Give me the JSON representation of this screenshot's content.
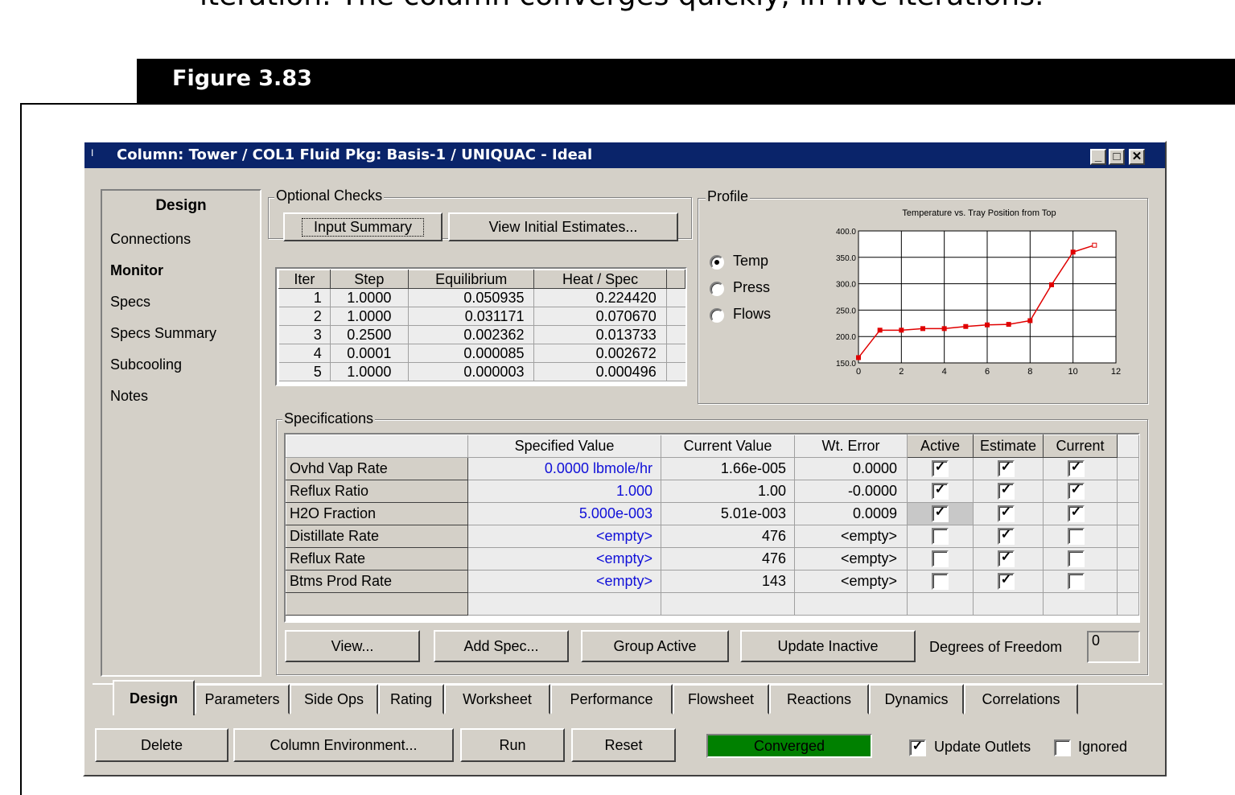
{
  "doc": {
    "top_text": "iteration. The column converges quickly, in five iterations.",
    "figure_title": "Figure 3.83"
  },
  "window": {
    "title": "Column: Tower / COL1  Fluid Pkg: Basis-1 / UNIQUAC - Ideal",
    "title_icon": "I",
    "minimize": "_",
    "maximize": "□",
    "close": "✕"
  },
  "nav": {
    "header": "Design",
    "items": [
      "Connections",
      "Monitor",
      "Specs",
      "Specs Summary",
      "Subcooling",
      "Notes"
    ],
    "selected": "Monitor"
  },
  "optional_checks": {
    "label": "Optional Checks",
    "input_summary": "Input Summary",
    "view_initial": "View Initial Estimates..."
  },
  "iterations": {
    "headers": [
      "Iter",
      "Step",
      "Equilibrium",
      "Heat / Spec"
    ],
    "rows": [
      [
        "1",
        "1.0000",
        "0.050935",
        "0.224420"
      ],
      [
        "2",
        "1.0000",
        "0.031171",
        "0.070670"
      ],
      [
        "3",
        "0.2500",
        "0.002362",
        "0.013733"
      ],
      [
        "4",
        "0.0001",
        "0.000085",
        "0.002672"
      ],
      [
        "5",
        "1.0000",
        "0.000003",
        "0.000496"
      ]
    ]
  },
  "profile": {
    "label": "Profile",
    "options": [
      "Temp",
      "Press",
      "Flows"
    ],
    "selected": "Temp"
  },
  "chart_data": {
    "type": "line",
    "title": "Temperature vs. Tray Position from Top",
    "xlabel": "",
    "ylabel": "",
    "xlim": [
      0,
      12
    ],
    "ylim": [
      150,
      400
    ],
    "x_ticks": [
      "0",
      "2",
      "4",
      "6",
      "8",
      "10",
      "12"
    ],
    "y_ticks": [
      "150.0",
      "200.0",
      "250.0",
      "300.0",
      "350.0",
      "400.0"
    ],
    "grid": true,
    "color": "#e00000",
    "series": [
      {
        "x": [
          0,
          1,
          2,
          3,
          4,
          5,
          6,
          7,
          8,
          9,
          10,
          11
        ],
        "y": [
          160,
          212,
          212,
          215,
          215,
          219,
          222,
          223,
          230,
          298,
          360,
          373
        ]
      }
    ]
  },
  "specifications": {
    "label": "Specifications",
    "headers": [
      "",
      "Specified Value",
      "Current Value",
      "Wt. Error",
      "Active",
      "Estimate",
      "Current"
    ],
    "rows": [
      {
        "name": "Ovhd Vap Rate",
        "spec": "0.0000 lbmole/hr",
        "current": "1.66e-005",
        "error": "0.0000",
        "active": true,
        "estimate": true,
        "cur": true
      },
      {
        "name": "Reflux Ratio",
        "spec": "1.000",
        "current": "1.00",
        "error": "-0.0000",
        "active": true,
        "estimate": true,
        "cur": true
      },
      {
        "name": "H2O Fraction",
        "spec": "5.000e-003",
        "current": "5.01e-003",
        "error": "0.0009",
        "active": true,
        "estimate": true,
        "cur": true
      },
      {
        "name": "Distillate Rate",
        "spec": "<empty>",
        "current": "476",
        "error": "<empty>",
        "active": false,
        "estimate": true,
        "cur": false
      },
      {
        "name": "Reflux Rate",
        "spec": "<empty>",
        "current": "476",
        "error": "<empty>",
        "active": false,
        "estimate": true,
        "cur": false
      },
      {
        "name": "Btms Prod Rate",
        "spec": "<empty>",
        "current": "143",
        "error": "<empty>",
        "active": false,
        "estimate": true,
        "cur": false
      }
    ],
    "check_mark": "✓"
  },
  "spec_buttons": {
    "view": "View...",
    "add": "Add Spec...",
    "group": "Group Active",
    "update": "Update Inactive",
    "dof_label": "Degrees of Freedom",
    "dof_value": "0"
  },
  "tabs": [
    "Design",
    "Parameters",
    "Side Ops",
    "Rating",
    "Worksheet",
    "Performance",
    "Flowsheet",
    "Reactions",
    "Dynamics",
    "Correlations"
  ],
  "active_tab": "Design",
  "bottom": {
    "delete": "Delete",
    "column_env": "Column Environment...",
    "run": "Run",
    "reset": "Reset",
    "status": "Converged",
    "status_color": "#008000",
    "update_outlets": "Update Outlets",
    "update_outlets_checked": true,
    "ignored": "Ignored",
    "ignored_checked": false
  }
}
